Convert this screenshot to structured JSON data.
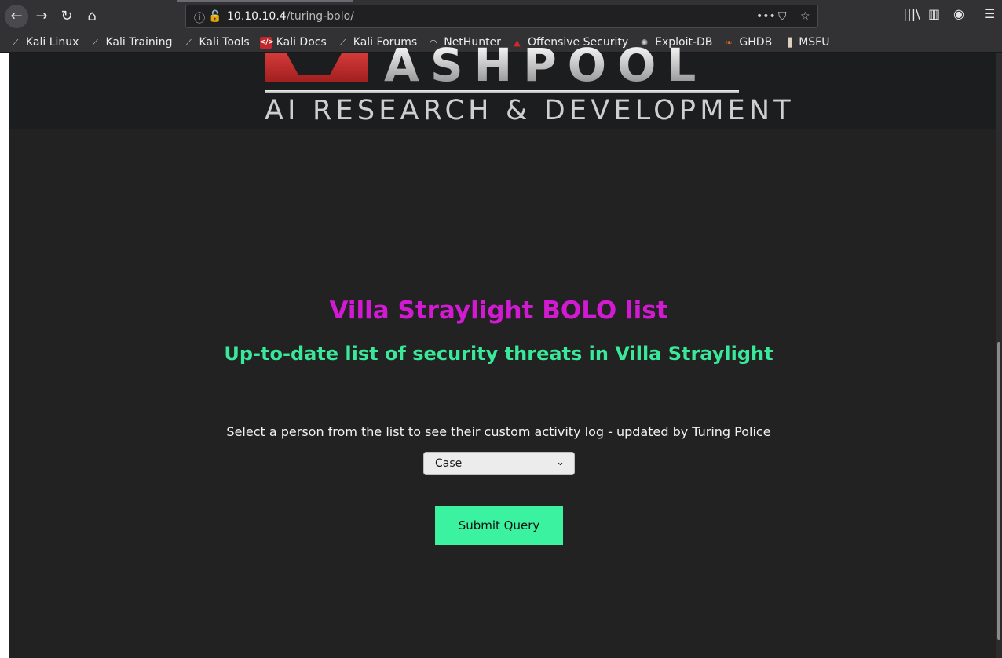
{
  "browser": {
    "url_host": "10.10.10.4",
    "url_path": "/turing-bolo/",
    "bookmarks": [
      {
        "label": "Kali Linux",
        "icon": "kali-icon"
      },
      {
        "label": "Kali Training",
        "icon": "kali-icon"
      },
      {
        "label": "Kali Tools",
        "icon": "kali-icon"
      },
      {
        "label": "Kali Docs",
        "icon": "kali-docs-icon"
      },
      {
        "label": "Kali Forums",
        "icon": "kali-icon"
      },
      {
        "label": "NetHunter",
        "icon": "nethunter-icon"
      },
      {
        "label": "Offensive Security",
        "icon": "offsec-icon"
      },
      {
        "label": "Exploit-DB",
        "icon": "exploitdb-icon"
      },
      {
        "label": "GHDB",
        "icon": "ghdb-icon"
      },
      {
        "label": "MSFU",
        "icon": "msfu-icon"
      }
    ]
  },
  "banner": {
    "logo_word": "ASHPOOL",
    "logo_sub": "AI RESEARCH  & DEVELOPMENT"
  },
  "page": {
    "heading": "Villa Straylight BOLO list",
    "subheading": "Up-to-date list of security threats in Villa Straylight",
    "instructions": "Select a person from the list to see their custom activity log - updated by Turing Police",
    "select_value": "Case",
    "submit_label": "Submit Query"
  },
  "colors": {
    "heading": "#d21ad2",
    "subheading": "#3ae89a",
    "button": "#3af2a0",
    "background": "#222222"
  }
}
